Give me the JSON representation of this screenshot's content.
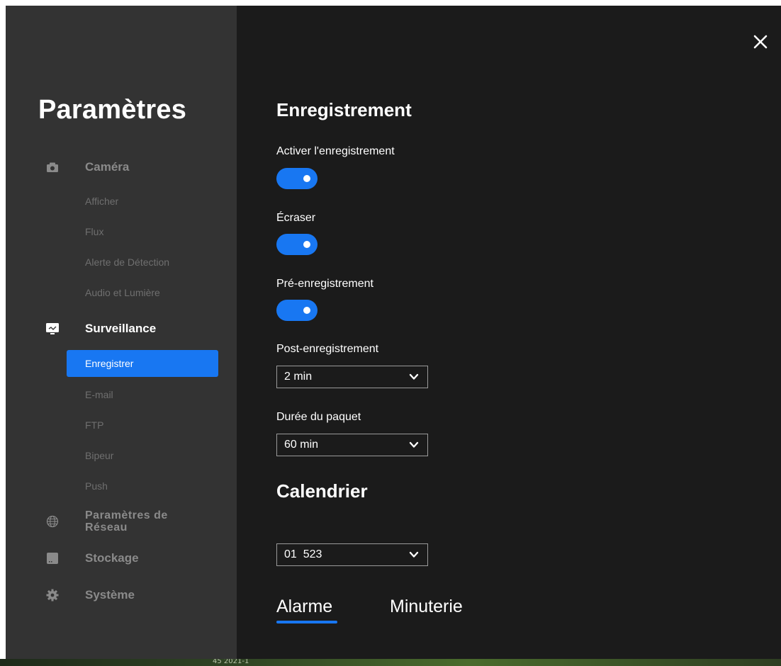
{
  "sidebar": {
    "title": "Paramètres",
    "groups": [
      {
        "label": "Caméra",
        "icon": "camera-icon"
      },
      {
        "label": "Surveillance",
        "icon": "monitor-icon"
      },
      {
        "label": "Paramètres de Réseau",
        "icon": "globe-icon"
      },
      {
        "label": "Stockage",
        "icon": "storage-icon"
      },
      {
        "label": "Système",
        "icon": "gear-icon"
      }
    ],
    "camera_items": [
      "Afficher",
      "Flux",
      "Alerte de Détection",
      "Audio et Lumière"
    ],
    "surveillance_items": [
      "Enregistrer",
      "E-mail",
      "FTP",
      "Bipeur",
      "Push"
    ],
    "network_label_line1": "Paramètres de",
    "network_label_line2": "Réseau"
  },
  "main": {
    "title": "Enregistrement",
    "enable_recording": {
      "label": "Activer l'enregistrement",
      "on": true
    },
    "overwrite": {
      "label": "Écraser",
      "on": true
    },
    "pre_recording": {
      "label": "Pré-enregistrement",
      "on": true
    },
    "post_recording": {
      "label": "Post-enregistrement",
      "value": "2 min"
    },
    "package_duration": {
      "label": "Durée du paquet",
      "value": "60 min"
    },
    "schedule_title": "Calendrier",
    "schedule_select": {
      "value": "01  523"
    },
    "tabs": [
      "Alarme",
      "Minuterie"
    ],
    "active_tab": "Alarme"
  },
  "background_text": "45  2021-1",
  "colors": {
    "accent": "#1877f2",
    "panel": "#1b1b1b",
    "sidebar": "#333333"
  }
}
